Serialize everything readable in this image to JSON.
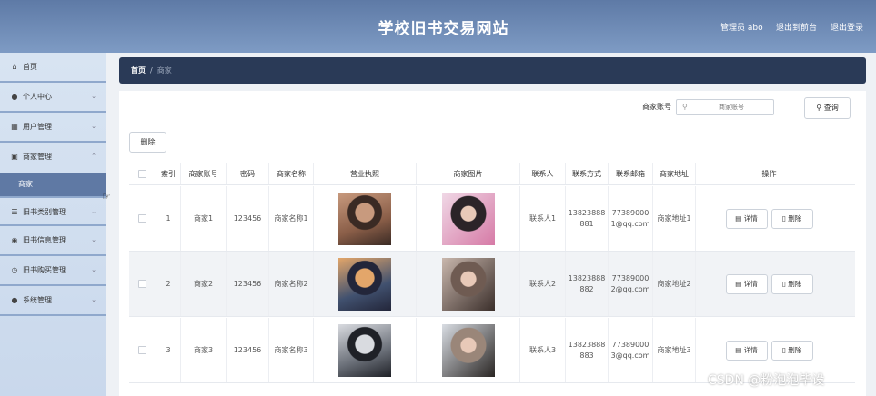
{
  "header": {
    "title": "学校旧书交易网站",
    "user": "管理员 abo",
    "backend": "退出到前台",
    "logout": "退出登录"
  },
  "sidebar": {
    "items": [
      {
        "label": "首页",
        "icon": "home-icon"
      },
      {
        "label": "个人中心",
        "icon": "user-icon"
      },
      {
        "label": "用户管理",
        "icon": "briefcase-icon"
      },
      {
        "label": "商家管理",
        "icon": "shop-icon"
      },
      {
        "label": "旧书类别管理",
        "icon": "list-icon"
      },
      {
        "label": "旧书信息管理",
        "icon": "gauge-icon"
      },
      {
        "label": "旧书购买管理",
        "icon": "clock-icon"
      },
      {
        "label": "系统管理",
        "icon": "person-icon"
      }
    ],
    "submenu_active": "商家"
  },
  "breadcrumb": {
    "home": "首页",
    "sep": "/",
    "current": "商家"
  },
  "search": {
    "label": "商家账号",
    "placeholder": "商家账号",
    "button": "查询"
  },
  "toolbar": {
    "delete": "删除"
  },
  "table": {
    "headers": [
      "索引",
      "商家账号",
      "密码",
      "商家名称",
      "营业执照",
      "商家图片",
      "联系人",
      "联系方式",
      "联系邮箱",
      "商家地址",
      "操作"
    ],
    "detail_label": "详情",
    "delete_label": "删除",
    "rows": [
      {
        "index": "1",
        "account": "商家1",
        "password": "123456",
        "name": "商家名称1",
        "contact": "联系人1",
        "phone": "13823888881",
        "email": "773890001@qq.com",
        "address": "商家地址1"
      },
      {
        "index": "2",
        "account": "商家2",
        "password": "123456",
        "name": "商家名称2",
        "contact": "联系人2",
        "phone": "13823888882",
        "email": "773890002@qq.com",
        "address": "商家地址2"
      },
      {
        "index": "3",
        "account": "商家3",
        "password": "123456",
        "name": "商家名称3",
        "contact": "联系人3",
        "phone": "13823888883",
        "email": "773890003@qq.com",
        "address": "商家地址3"
      }
    ]
  },
  "watermark": "CSDN @粉泡泡毕设",
  "colors": {
    "header": "#6b86b0",
    "sidebar": "#d2dfef",
    "active": "#5f79a4",
    "breadcrumb": "#2a3a57"
  }
}
